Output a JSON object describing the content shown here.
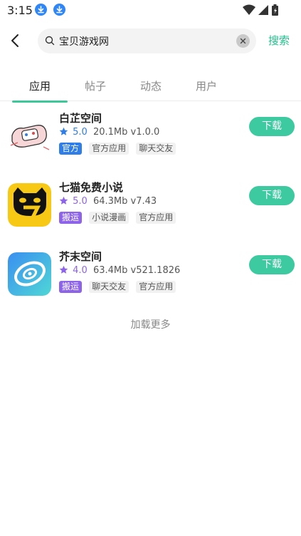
{
  "status_bar": {
    "time": "3:15"
  },
  "search": {
    "query": "宝贝游戏网",
    "action_label": "搜索"
  },
  "tabs": [
    {
      "label": "应用",
      "active": true
    },
    {
      "label": "帖子",
      "active": false
    },
    {
      "label": "动态",
      "active": false
    },
    {
      "label": "用户",
      "active": false
    }
  ],
  "apps": [
    {
      "name": "白芷空间",
      "rating": "5.0",
      "rating_color": "#2f7de8",
      "size": "20.1Mb",
      "version": "v1.0.0",
      "tags": [
        {
          "label": "官方",
          "kind": "official"
        },
        {
          "label": "官方应用",
          "kind": "plain"
        },
        {
          "label": "聊天交友",
          "kind": "plain"
        }
      ],
      "download_label": "下载"
    },
    {
      "name": "七猫免费小说",
      "rating": "5.0",
      "rating_color": "#8c63e9",
      "size": "64.3Mb",
      "version": "v7.43",
      "tags": [
        {
          "label": "搬运",
          "kind": "port"
        },
        {
          "label": "小说漫画",
          "kind": "plain"
        },
        {
          "label": "官方应用",
          "kind": "plain"
        }
      ],
      "download_label": "下载"
    },
    {
      "name": "芥末空间",
      "rating": "4.0",
      "rating_color": "#8c63e9",
      "size": "63.4Mb",
      "version": "v521.1826",
      "tags": [
        {
          "label": "搬运",
          "kind": "port"
        },
        {
          "label": "聊天交友",
          "kind": "plain"
        },
        {
          "label": "官方应用",
          "kind": "plain"
        }
      ],
      "download_label": "下载"
    }
  ],
  "load_more": "加载更多",
  "colors": {
    "accent": "#3dcaa0",
    "search_action": "#22c08a",
    "official_tag": "#2f7de8",
    "port_tag": "#8c63e9"
  }
}
